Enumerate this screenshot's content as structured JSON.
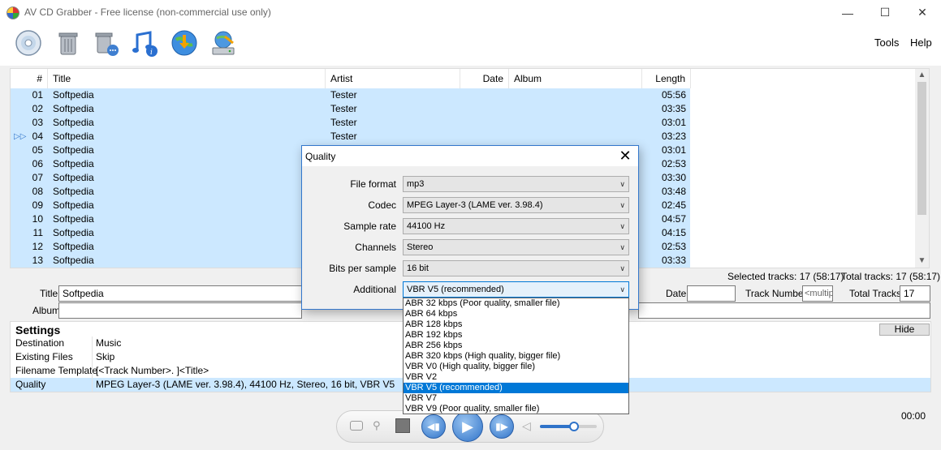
{
  "window": {
    "title": "AV CD Grabber - Free license (non-commercial use only)"
  },
  "menu": {
    "tools": "Tools",
    "help": "Help"
  },
  "toolbar": {
    "icons": [
      "cd-icon",
      "trash-icon",
      "trash-options-icon",
      "music-info-icon",
      "download-globe-icon",
      "network-drive-icon"
    ]
  },
  "columns": {
    "num": "#",
    "title": "Title",
    "artist": "Artist",
    "date": "Date",
    "album": "Album",
    "length": "Length"
  },
  "tracks": [
    {
      "num": "01",
      "title": "Softpedia",
      "artist": "Tester",
      "length": "05:56"
    },
    {
      "num": "02",
      "title": "Softpedia",
      "artist": "Tester",
      "length": "03:35"
    },
    {
      "num": "03",
      "title": "Softpedia",
      "artist": "Tester",
      "length": "03:01"
    },
    {
      "num": "04",
      "title": "Softpedia",
      "artist": "Tester",
      "length": "03:23",
      "playing": true
    },
    {
      "num": "05",
      "title": "Softpedia",
      "artist": "",
      "length": "03:01"
    },
    {
      "num": "06",
      "title": "Softpedia",
      "artist": "",
      "length": "02:53"
    },
    {
      "num": "07",
      "title": "Softpedia",
      "artist": "",
      "length": "03:30"
    },
    {
      "num": "08",
      "title": "Softpedia",
      "artist": "",
      "length": "03:48"
    },
    {
      "num": "09",
      "title": "Softpedia",
      "artist": "",
      "length": "02:45"
    },
    {
      "num": "10",
      "title": "Softpedia",
      "artist": "",
      "length": "04:57"
    },
    {
      "num": "11",
      "title": "Softpedia",
      "artist": "",
      "length": "04:15"
    },
    {
      "num": "12",
      "title": "Softpedia",
      "artist": "",
      "length": "02:53"
    },
    {
      "num": "13",
      "title": "Softpedia",
      "artist": "",
      "length": "03:33"
    }
  ],
  "status": {
    "selected": "Selected tracks: 17 (58:17)",
    "total": "Total tracks: 17 (58:17)"
  },
  "fields": {
    "title_label": "Title",
    "title_value": "Softpedia",
    "album_label": "Album",
    "album_value": "",
    "date_label": "Date",
    "date_value": "",
    "track_number_label": "Track Number",
    "track_number_value": "<multip",
    "total_tracks_label": "Total Tracks",
    "total_tracks_value": "17"
  },
  "settings": {
    "heading": "Settings",
    "hide_label": "Hide",
    "rows": [
      {
        "key": "Destination",
        "value": "Music"
      },
      {
        "key": "Existing Files",
        "value": "Skip"
      },
      {
        "key": "Filename Template",
        "value": "[<Track Number>. ]<Title>"
      },
      {
        "key": "Quality",
        "value": "MPEG Layer-3 (LAME ver. 3.98.4), 44100 Hz, Stereo, 16 bit, VBR V5",
        "selected": true
      }
    ]
  },
  "player": {
    "time": "00:00",
    "volume_level": 0.6
  },
  "dialog": {
    "title": "Quality",
    "rows": [
      {
        "label": "File format",
        "value": "mp3"
      },
      {
        "label": "Codec",
        "value": "MPEG Layer-3 (LAME ver. 3.98.4)"
      },
      {
        "label": "Sample rate",
        "value": "44100 Hz"
      },
      {
        "label": "Channels",
        "value": "Stereo"
      },
      {
        "label": "Bits per sample",
        "value": "16 bit"
      },
      {
        "label": "Additional",
        "value": "VBR V5 (recommended)"
      }
    ],
    "options": [
      "ABR 32 kbps (Poor quality, smaller file)",
      "ABR 64 kbps",
      "ABR 128 kbps",
      "ABR 192 kbps",
      "ABR 256 kbps",
      "ABR 320 kbps (High quality, bigger file)",
      "VBR V0 (High quality, bigger file)",
      "VBR V2",
      "VBR V5 (recommended)",
      "VBR V7",
      "VBR V9 (Poor quality, smaller file)"
    ],
    "selected_option": 8
  },
  "colors": {
    "selection": "#cce8ff",
    "accent": "#0078d7"
  }
}
